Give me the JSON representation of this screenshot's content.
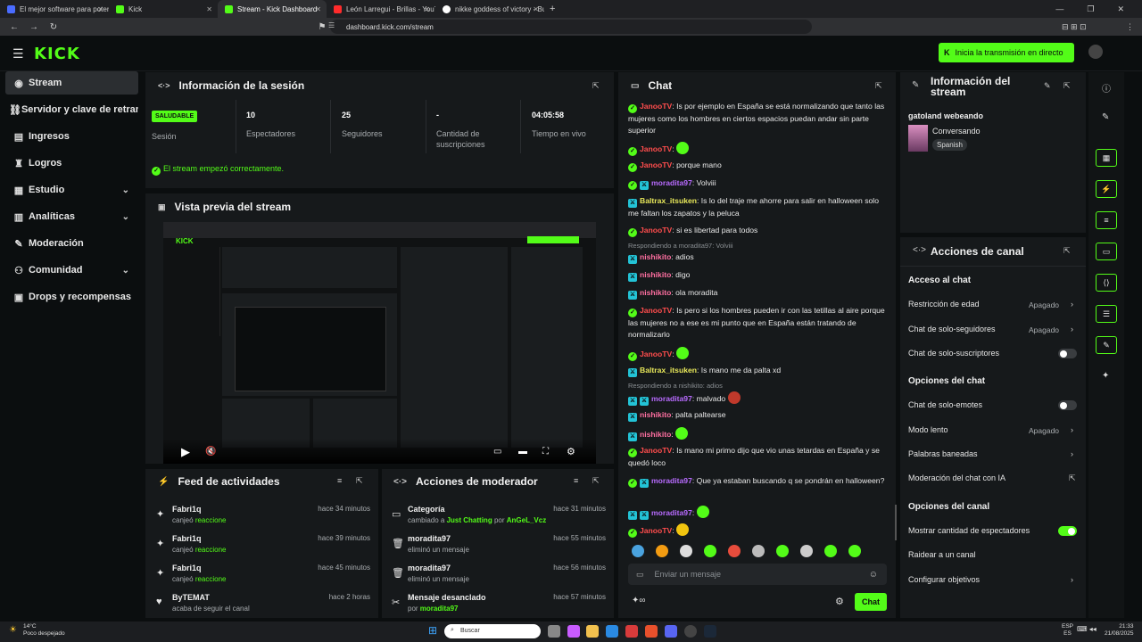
{
  "browser": {
    "tabs": [
      {
        "label": "El mejor software para potenciar tu s"
      },
      {
        "label": "Kick"
      },
      {
        "label": "Stream - Kick Dashboard"
      },
      {
        "label": "León Larregui - Brillas - YouTube"
      },
      {
        "label": "nikke goddess of victory - Buscar con"
      }
    ],
    "url": "dashboard.kick.com/stream"
  },
  "header": {
    "logo": "KICK",
    "go_live": "Inicia la transmisión en directo"
  },
  "sidebar": {
    "items": [
      {
        "label": "Stream"
      },
      {
        "label": "Servidor y clave de retransmisión"
      },
      {
        "label": "Ingresos"
      },
      {
        "label": "Logros"
      },
      {
        "label": "Estudio"
      },
      {
        "label": "Analíticas"
      },
      {
        "label": "Moderación"
      },
      {
        "label": "Comunidad"
      },
      {
        "label": "Drops y recompensas"
      }
    ]
  },
  "session": {
    "title": "Información de la sesión",
    "status_badge": "SALUDABLE",
    "status_label": "Sesión",
    "viewers": "10",
    "viewers_label": "Espectadores",
    "followers": "25",
    "followers_label": "Seguidores",
    "subs": "-",
    "subs_label": "Cantidad de suscripciones",
    "live_time": "04:05:58",
    "live_time_label": "Tiempo en vivo",
    "ok_message": "El stream empezó correctamente."
  },
  "preview": {
    "title": "Vista previa del stream"
  },
  "feed": {
    "title": "Feed de actividades",
    "items": [
      {
        "name": "Fabri1q",
        "action": "canjeó",
        "target": "reaccione",
        "time": "hace 34 minutos"
      },
      {
        "name": "Fabri1q",
        "action": "canjeó",
        "target": "reaccione",
        "time": "hace 39 minutos"
      },
      {
        "name": "Fabri1q",
        "action": "canjeó",
        "target": "reaccione",
        "time": "hace 45 minutos"
      },
      {
        "name": "ByTEMAT",
        "action": "acaba de seguir el canal",
        "target": "",
        "time": "hace 2 horas"
      }
    ]
  },
  "modactions": {
    "title": "Acciones de moderador",
    "items": [
      {
        "name": "Categoría",
        "line": "cambiado a",
        "target": "Just Chatting",
        "by": "por",
        "user": "AnGeL_Vcz",
        "time": "hace 31 minutos"
      },
      {
        "name": "moradita97",
        "line": "eliminó un mensaje",
        "target": "",
        "by": "",
        "user": "",
        "time": "hace 55 minutos"
      },
      {
        "name": "moradita97",
        "line": "eliminó un mensaje",
        "target": "",
        "by": "",
        "user": "",
        "time": "hace 56 minutos"
      },
      {
        "name": "Mensaje desanclado",
        "line": "por",
        "target": "moradita97",
        "by": "",
        "user": "",
        "time": "hace 57 minutos"
      }
    ]
  },
  "chat": {
    "title": "Chat",
    "placeholder": "Enviar un mensaje",
    "send_label": "Chat",
    "lines": [
      {
        "user": "JanooTV",
        "color": "#ff4d4d",
        "text": "Is por ejemplo en España se está normalizando que tanto las mujeres como los hombres en ciertos espacios puedan andar sin parte superior"
      },
      {
        "user": "JanooTV",
        "color": "#ff4d4d",
        "text": ""
      },
      {
        "user": "JanooTV",
        "color": "#ff4d4d",
        "text": "porque mano"
      },
      {
        "user": "moradita97",
        "color": "#b86bff",
        "text": "Volviii"
      },
      {
        "user": "Baltrax_itsuken",
        "color": "#e8e85a",
        "text": "Is lo del traje me ahorre para salir en halloween solo me faltan los zapatos y la peluca"
      },
      {
        "user": "JanooTV",
        "color": "#ff4d4d",
        "text": "si es libertad para todos"
      },
      {
        "user": "nishikito",
        "color": "#ff6fa1",
        "text": "adios"
      },
      {
        "user": "nishikito",
        "color": "#ff6fa1",
        "text": "digo"
      },
      {
        "user": "nishikito",
        "color": "#ff6fa1",
        "text": "ola moradita"
      },
      {
        "user": "JanooTV",
        "color": "#ff4d4d",
        "text": "Is pero si los hombres pueden ir con las tetillas al aire porque las mujeres no a ese es mi punto que en España están tratando de normalizarlo"
      },
      {
        "user": "JanooTV",
        "color": "#ff4d4d",
        "text": ""
      },
      {
        "user": "Baltrax_itsuken",
        "color": "#e8e85a",
        "text": "Is mano me da palta xd"
      },
      {
        "user": "moradita97",
        "color": "#b86bff",
        "text": "malvado"
      },
      {
        "user": "nishikito",
        "color": "#ff6fa1",
        "text": "palta paltearse"
      },
      {
        "user": "nishikito",
        "color": "#ff6fa1",
        "text": ""
      },
      {
        "user": "JanooTV",
        "color": "#ff4d4d",
        "text": "Is mano mi primo dijo que vio unas tetardas en España y se quedó loco"
      },
      {
        "user": "moradita97",
        "color": "#b86bff",
        "text": "Que ya estaban buscando q se pondrán en halloween?"
      },
      {
        "user": "moradita97",
        "color": "#b86bff",
        "text": ""
      },
      {
        "user": "JanooTV",
        "color": "#ff4d4d",
        "text": ""
      }
    ],
    "reply1": "Respondiendo a moradita97: Volviii",
    "reply2": "Respondiendo a nishikito: adios"
  },
  "stream_info": {
    "title": "Información del stream",
    "channel": "gatoland webeando",
    "category": "Conversando",
    "language": "Spanish"
  },
  "channel_actions": {
    "title": "Acciones de canal",
    "chat_access": "Acceso al chat",
    "age": "Restricción de edad",
    "age_val": "Apagado",
    "followers_only": "Chat de solo-seguidores",
    "followers_val": "Apagado",
    "subs_only": "Chat de solo-suscriptores",
    "chat_options": "Opciones del chat",
    "emotes_only": "Chat de solo-emotes",
    "slow": "Modo lento",
    "slow_val": "Apagado",
    "banned": "Palabras baneadas",
    "ai_mod": "Moderación del chat con IA",
    "channel_options": "Opciones del canal",
    "show_viewers": "Mostrar cantidad de espectadores",
    "raid": "Raidear a un canal",
    "goals": "Configurar objetivos"
  },
  "taskbar": {
    "weather_temp": "14°C",
    "weather_text": "Poco despejado",
    "search": "Buscar",
    "lang1": "ESP",
    "lang2": "ES",
    "time": "21:33",
    "date": "21/08/2025"
  },
  "colors": {
    "accent": "#53fc18",
    "bg": "#0b0e0f",
    "panel": "#16191b"
  }
}
